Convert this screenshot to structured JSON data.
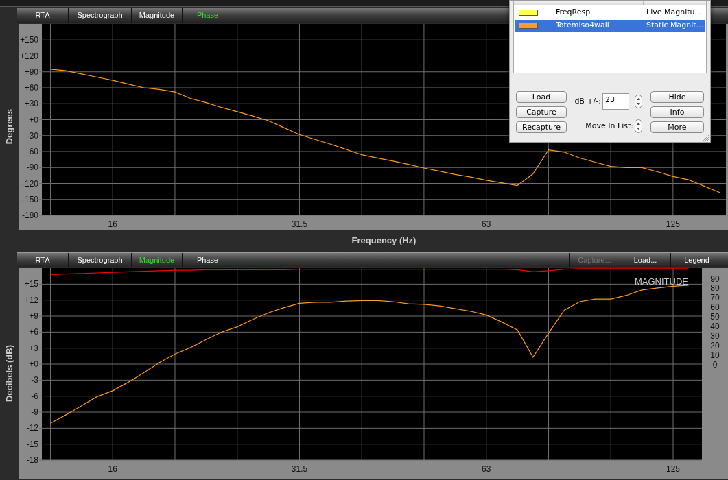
{
  "phase_panel": {
    "tabs": [
      {
        "label": "RTA",
        "selected": false
      },
      {
        "label": "Spectrograph",
        "selected": false
      },
      {
        "label": "Magnitude",
        "selected": false
      },
      {
        "label": "Phase",
        "selected": true
      }
    ],
    "chart_data": {
      "type": "line",
      "xlabel": "Frequency (Hz)",
      "ylabel": "Degrees",
      "categories": [
        null,
        null,
        null,
        null,
        "16",
        null,
        null,
        null,
        null,
        null,
        null,
        null,
        null,
        null,
        null,
        null,
        "31.5",
        null,
        null,
        null,
        null,
        null,
        null,
        null,
        null,
        null,
        null,
        null,
        "63",
        null,
        null,
        null,
        null,
        null,
        null,
        null,
        null,
        null,
        null,
        null,
        "125",
        null,
        null,
        null
      ],
      "series": [
        {
          "color": "#ff9a1a",
          "values": [
            95,
            92,
            86,
            80,
            74,
            67,
            60,
            57,
            52,
            40,
            32,
            23,
            15,
            7,
            -2,
            -15,
            -28,
            -37,
            -46,
            -56,
            -66,
            -72,
            -78,
            -84,
            -91,
            -97,
            -103,
            -108,
            -114,
            -119,
            -124,
            -102,
            -57,
            -61,
            -72,
            -80,
            -88,
            -90,
            -90,
            -98,
            -107,
            -113,
            -125,
            -137
          ]
        }
      ],
      "grid": true,
      "ylim": [
        -180,
        180
      ],
      "yticks": [
        {
          "value": 150,
          "label": "+150"
        },
        {
          "value": 120,
          "label": "+120"
        },
        {
          "value": 90,
          "label": "+90"
        },
        {
          "value": 60,
          "label": "+60"
        },
        {
          "value": 30,
          "label": "+30"
        },
        {
          "value": 0,
          "label": "+0"
        },
        {
          "value": -30,
          "label": "-30"
        },
        {
          "value": -60,
          "label": "-60"
        },
        {
          "value": -90,
          "label": "-90"
        },
        {
          "value": -120,
          "label": "-120"
        },
        {
          "value": -150,
          "label": "-150"
        },
        {
          "value": -180,
          "label": "-180"
        }
      ]
    }
  },
  "magnitude_panel": {
    "tabs": [
      {
        "label": "RTA",
        "selected": false
      },
      {
        "label": "Spectrograph",
        "selected": false
      },
      {
        "label": "Magnitude",
        "selected": true
      },
      {
        "label": "Phase",
        "selected": false
      }
    ],
    "buttons": [
      {
        "label": "Capture...",
        "disabled": true
      },
      {
        "label": "Load...",
        "disabled": false
      },
      {
        "label": "Legend",
        "disabled": false
      }
    ],
    "overlay_label": "MAGNITUDE",
    "right_axis_labels": [
      "90",
      "80",
      "70",
      "60",
      "50",
      "40",
      "30",
      "20",
      "10",
      "0"
    ],
    "chart_data": {
      "type": "line",
      "ylabel": "Decibels (dB)",
      "categories": [
        null,
        null,
        null,
        null,
        "16",
        null,
        null,
        null,
        null,
        null,
        null,
        null,
        null,
        null,
        null,
        null,
        "31.5",
        null,
        null,
        null,
        null,
        null,
        null,
        null,
        null,
        null,
        null,
        null,
        "63",
        null,
        null,
        null,
        null,
        null,
        null,
        null,
        null,
        null,
        null,
        null,
        "125",
        null
      ],
      "series": [
        {
          "color": "#ff0000",
          "values": [
            16.8,
            16.9,
            17.0,
            17.1,
            17.2,
            17.3,
            17.4,
            17.5,
            17.6,
            17.6,
            17.7,
            17.7,
            17.7,
            17.7,
            17.7,
            17.7,
            17.8,
            17.8,
            17.8,
            17.8,
            17.8,
            17.8,
            17.8,
            17.8,
            17.8,
            17.8,
            17.8,
            17.8,
            17.8,
            17.8,
            17.7,
            17.3,
            17.5,
            17.8,
            17.9,
            17.9,
            17.9,
            17.9,
            17.9,
            17.9,
            17.9,
            17.9
          ]
        },
        {
          "color": "#ff9a1a",
          "values": [
            -11.1,
            -9.5,
            -7.8,
            -6.1,
            -5,
            -3.4,
            -1.6,
            0.3,
            1.9,
            3.1,
            4.6,
            6.0,
            7.0,
            8.4,
            9.6,
            10.6,
            11.4,
            11.6,
            11.6,
            11.8,
            11.9,
            11.9,
            11.7,
            11.3,
            11.2,
            10.9,
            10.4,
            9.9,
            9.2,
            7.9,
            6.4,
            1.3,
            5.8,
            10.1,
            11.7,
            12.2,
            12.2,
            12.9,
            13.9,
            14.3,
            14.6,
            14.8
          ]
        }
      ],
      "grid": true,
      "ylim": [
        -18,
        18
      ],
      "yticks": [
        {
          "value": 15,
          "label": "+15"
        },
        {
          "value": 12,
          "label": "+12"
        },
        {
          "value": 9,
          "label": "+9"
        },
        {
          "value": 6,
          "label": "+6"
        },
        {
          "value": 3,
          "label": "+3"
        },
        {
          "value": 0,
          "label": "+0"
        },
        {
          "value": -3,
          "label": "-3"
        },
        {
          "value": -6,
          "label": "-6"
        },
        {
          "value": -9,
          "label": "-9"
        },
        {
          "value": -12,
          "label": "-12"
        },
        {
          "value": -15,
          "label": "-15"
        },
        {
          "value": -18,
          "label": "-18"
        }
      ]
    }
  },
  "legend_window": {
    "rows": [
      {
        "color": "#ffff55",
        "description": "FreqResp",
        "type": "Live Magnitu...",
        "selected": false
      },
      {
        "color": "#ff9a33",
        "description": "TotemIso4wall",
        "type": "Static Magnit...",
        "selected": true
      }
    ],
    "buttons_left": [
      "Load",
      "Capture",
      "Recapture"
    ],
    "db_label": "dB +/-:",
    "db_value": "23",
    "move_label": "Move In List:",
    "buttons_right": [
      "Hide",
      "Info",
      "More"
    ]
  }
}
